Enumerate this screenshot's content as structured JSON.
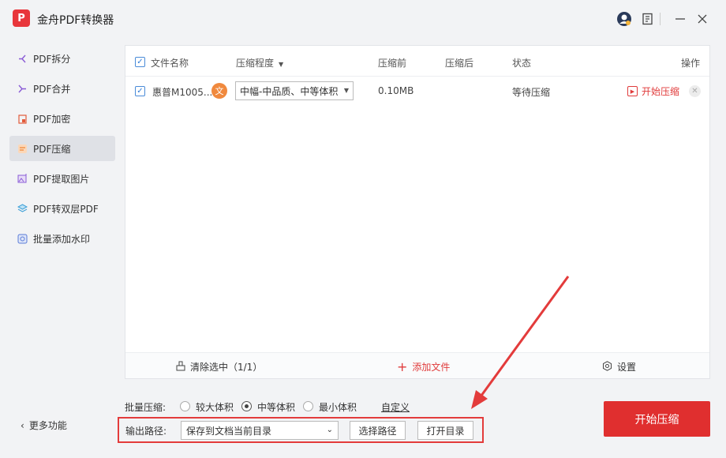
{
  "app": {
    "logo_text": "P",
    "title": "金舟PDF转换器"
  },
  "titlebar_icons": [
    "avatar-icon",
    "feedback-icon",
    "minimize-icon",
    "close-icon"
  ],
  "sidebar": {
    "items": [
      {
        "label": "PDF拆分",
        "icon": "split-icon",
        "color": "#8a5bd6"
      },
      {
        "label": "PDF合并",
        "icon": "merge-icon",
        "color": "#8a5bd6"
      },
      {
        "label": "PDF加密",
        "icon": "lock-icon",
        "color": "#e25b3b"
      },
      {
        "label": "PDF压缩",
        "icon": "compress-icon",
        "color": "#f08a3c"
      },
      {
        "label": "PDF提取图片",
        "icon": "image-icon",
        "color": "#8a5bd6"
      },
      {
        "label": "PDF转双层PDF",
        "icon": "layers-icon",
        "color": "#3fa0d8"
      },
      {
        "label": "批量添加水印",
        "icon": "watermark-icon",
        "color": "#5a7bd8"
      }
    ],
    "active_index": 3,
    "more_label": "更多功能"
  },
  "table": {
    "headers": {
      "name": "文件名称",
      "level": "压缩程度",
      "before": "压缩前",
      "after": "压缩后",
      "status": "状态",
      "action": "操作"
    },
    "row": {
      "name": "惠普M1005...",
      "badge": "文",
      "level": "中幅-中品质、中等体积",
      "before": "0.10MB",
      "after": "",
      "status": "等待压缩",
      "action": "开始压缩"
    }
  },
  "bottom_bar": {
    "clear": "清除选中（1/1）",
    "add": "添加文件",
    "settings": "设置"
  },
  "batch": {
    "label": "批量压缩:",
    "options": [
      "较大体积",
      "中等体积",
      "最小体积"
    ],
    "selected_index": 1,
    "custom": "自定义"
  },
  "output": {
    "label": "输出路径:",
    "path": "保存到文档当前目录",
    "choose": "选择路径",
    "open": "打开目录"
  },
  "start_button": "开始压缩",
  "colors": {
    "accent": "#e02f2f",
    "check": "#2f7bd6",
    "badge": "#f0893e"
  }
}
